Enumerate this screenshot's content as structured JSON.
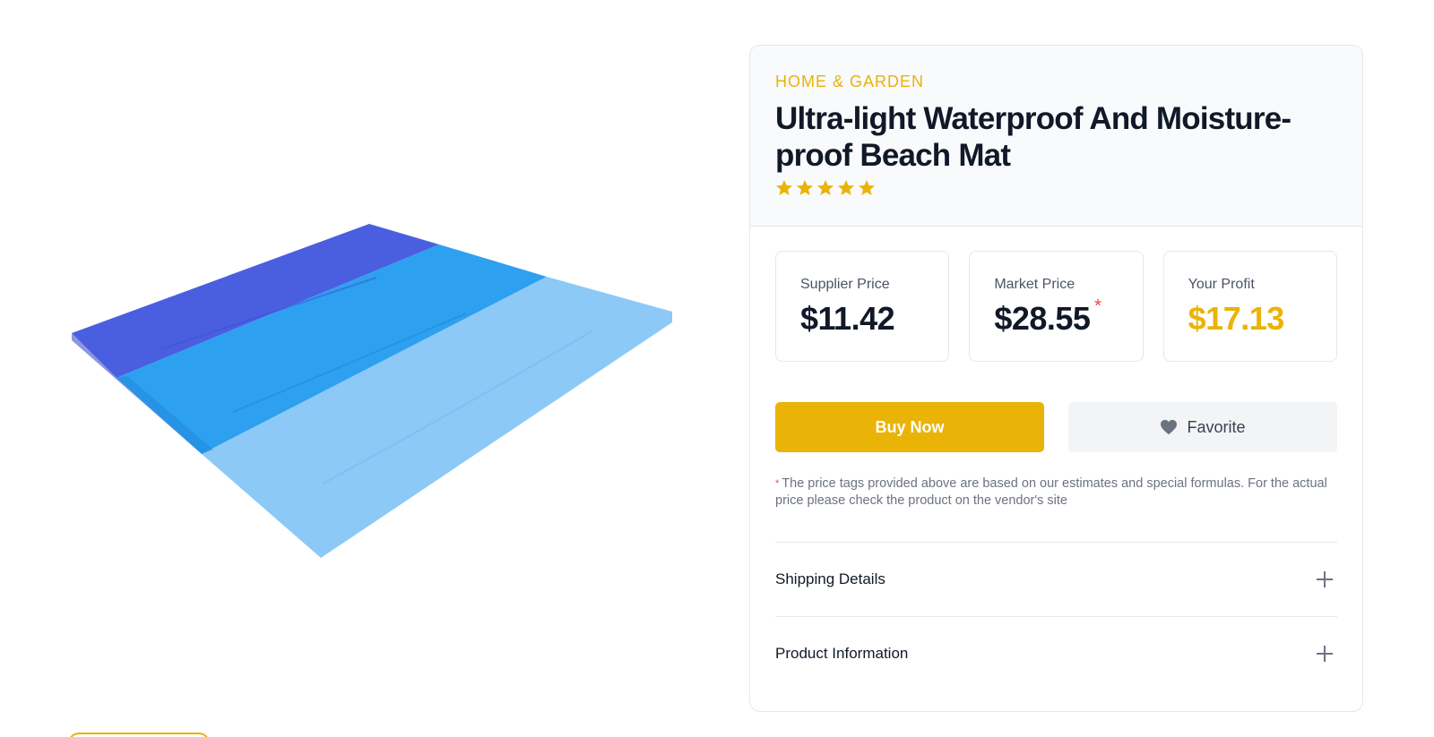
{
  "product": {
    "category": "HOME & GARDEN",
    "title": "Ultra-light Waterproof And Moisture-proof Beach Mat",
    "rating": 5,
    "rating_max": 5,
    "image_icon": "beach-mat-image"
  },
  "prices": {
    "supplier": {
      "label": "Supplier Price",
      "value": "$11.42"
    },
    "market": {
      "label": "Market Price",
      "value": "$28.55",
      "asterisk": "*"
    },
    "profit": {
      "label": "Your Profit",
      "value": "$17.13"
    }
  },
  "actions": {
    "buy_label": "Buy Now",
    "favorite_label": "Favorite",
    "favorite_icon": "heart-icon"
  },
  "note": {
    "asterisk": "*",
    "text": "The price tags provided above are based on our estimates and special formulas. For the actual price please check the product on the vendor's site"
  },
  "accordion": {
    "shipping_label": "Shipping Details",
    "product_info_label": "Product Information"
  },
  "colors": {
    "accent": "#eab308",
    "asterisk": "#ef4444"
  }
}
